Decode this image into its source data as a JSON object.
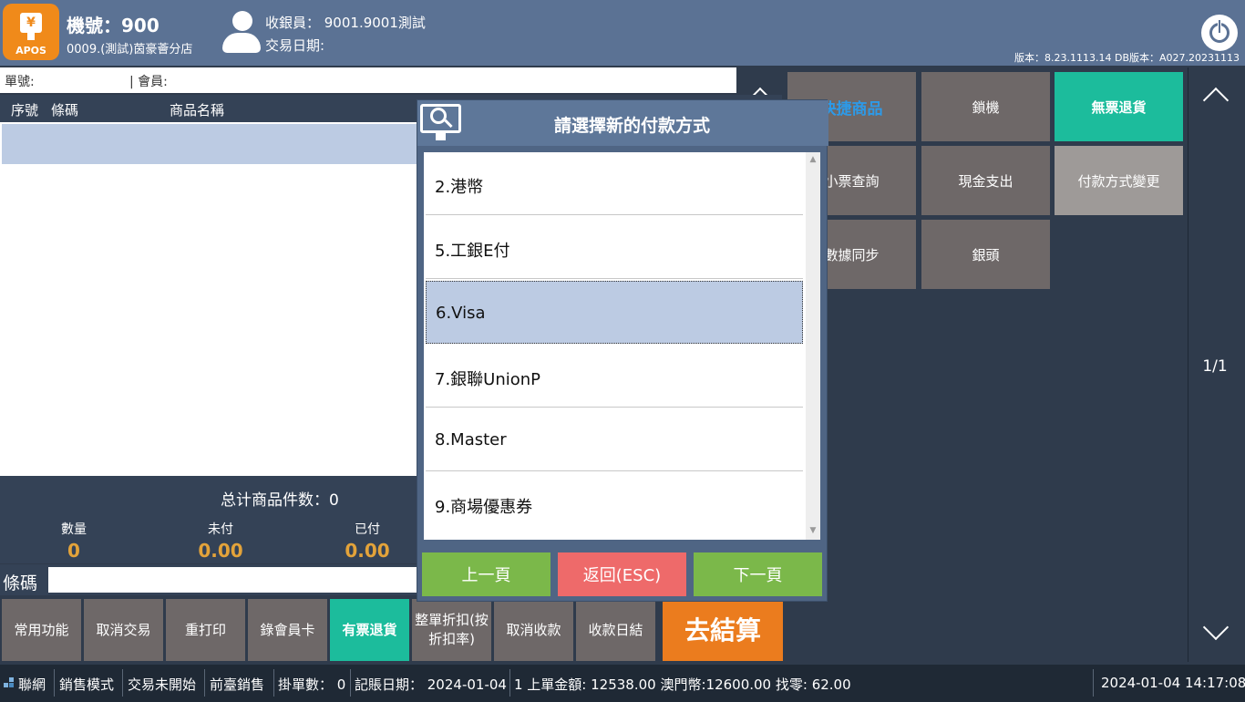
{
  "header": {
    "logo_text": "APOS",
    "logo_symbol": "¥",
    "machine": "機號：900",
    "store": "0009.(測試)茵豪薈分店",
    "cashier": "收銀員：  9001.9001測試",
    "trade_date": "交易日期:",
    "version": "版本：8.23.1113.14 DB版本：A027.20231113"
  },
  "order": {
    "order_no_label": "單號:",
    "member_label": "| 會員:"
  },
  "table": {
    "columns": [
      "序號",
      "條碼",
      "商品名稱"
    ]
  },
  "summary": {
    "total_items": "总计商品件数：0",
    "stats": [
      {
        "label": "數量",
        "value": "0"
      },
      {
        "label": "未付",
        "value": "0.00"
      },
      {
        "label": "已付",
        "value": "0.00"
      }
    ],
    "barcode_label": "條碼"
  },
  "bottom_buttons": [
    "常用功能",
    "取消交易",
    "重打印",
    "錄會員卡",
    "有票退貨",
    "整單折扣(按折扣率)",
    "取消收款",
    "收款日結",
    "去結算"
  ],
  "right_buttons": [
    "快捷商品",
    "鎖機",
    "無票退貨",
    "小票查詢",
    "現金支出",
    "付款方式變更",
    "數據同步",
    "銀頭"
  ],
  "pager": {
    "page": "1/1"
  },
  "modal": {
    "title": "請選擇新的付款方式",
    "items": [
      "2.港幣",
      "5.工銀E付",
      "6.Visa",
      "7.銀聯UnionP",
      "8.Master",
      "9.商場優惠券"
    ],
    "selected_index": 2,
    "prev": "上一頁",
    "back": "返回(ESC)",
    "next": "下一頁"
  },
  "status": {
    "network": "聯網",
    "mode": "銷售模式",
    "trade_state": "交易未開始",
    "front": "前臺銷售",
    "hold": "掛單數：  0",
    "account_date": "記賬日期：  2024-01-04",
    "last_amount": "1 上單金額: 12538.00  澳門幣:12600.00 找零: 62.00",
    "datetime": "2024-01-04 14:17:08"
  },
  "colors": {
    "header": "#5b7294",
    "accent_orange": "#eb7c1e",
    "teal": "#1cbc9c",
    "selected": "#bccbe3",
    "amount": "#e3a33a"
  }
}
